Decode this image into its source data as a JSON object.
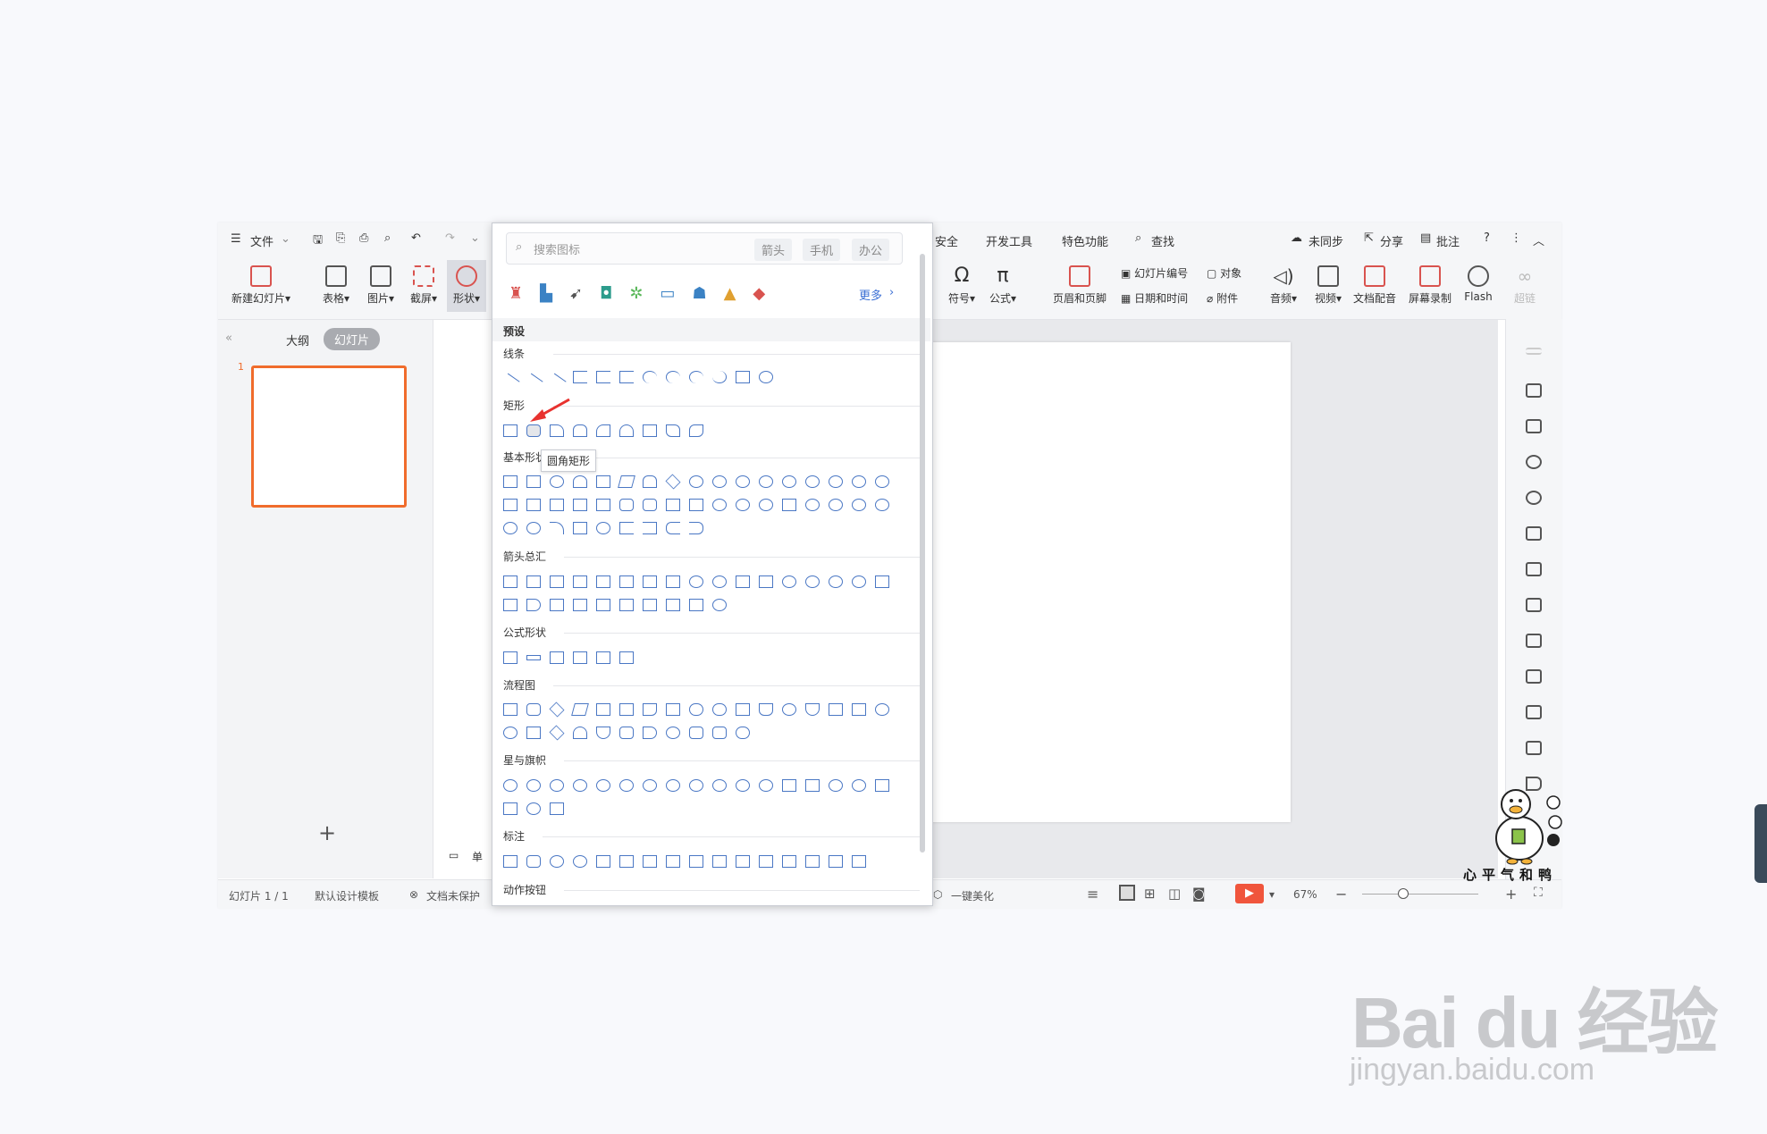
{
  "titlebar": {
    "menu_file": "文件",
    "tabs_right": [
      "安全",
      "开发工具",
      "特色功能"
    ],
    "search": "查找",
    "sync": "未同步",
    "share": "分享",
    "annotate": "批注"
  },
  "ribbon": {
    "new_slide": "新建幻灯片",
    "table": "表格",
    "picture": "图片",
    "screenshot": "截屏",
    "shape": "形状",
    "symbol": "符号",
    "formula": "公式",
    "header_footer": "页眉和页脚",
    "slide_number": "幻灯片编号",
    "object": "对象",
    "date_time": "日期和时间",
    "attachment": "附件",
    "audio": "音频",
    "video": "视频",
    "doc_dub": "文档配音",
    "screen_record": "屏幕录制",
    "flash": "Flash",
    "hyperlink": "超链"
  },
  "left_panel": {
    "tab_outline": "大纲",
    "tab_slides": "幻灯片",
    "slide_index": "1",
    "add": "+"
  },
  "popup": {
    "search_placeholder": "搜索图标",
    "tags": [
      "箭头",
      "手机",
      "办公"
    ],
    "more": "更多",
    "preset": "预设",
    "sections": [
      "线条",
      "矩形",
      "基本形状",
      "箭头总汇",
      "公式形状",
      "流程图",
      "星与旗帜",
      "标注",
      "动作按钮"
    ],
    "tooltip": "圆角矩形"
  },
  "statusbar": {
    "slide_count": "幻灯片 1 / 1",
    "template": "默认设计模板",
    "doc_protect": "文档未保护",
    "notes": "单",
    "beautify": "一键美化",
    "zoom": "67%"
  },
  "overlay": {
    "duck_caption": "心平气和鸭",
    "watermark_logo": "Bai du 经验",
    "watermark_url": "jingyan.baidu.com"
  },
  "colors": {
    "accent": "#f06c2c",
    "shape_blue": "#4a77c4",
    "play_red": "#f0553c",
    "arrow_red": "#e8322f"
  }
}
